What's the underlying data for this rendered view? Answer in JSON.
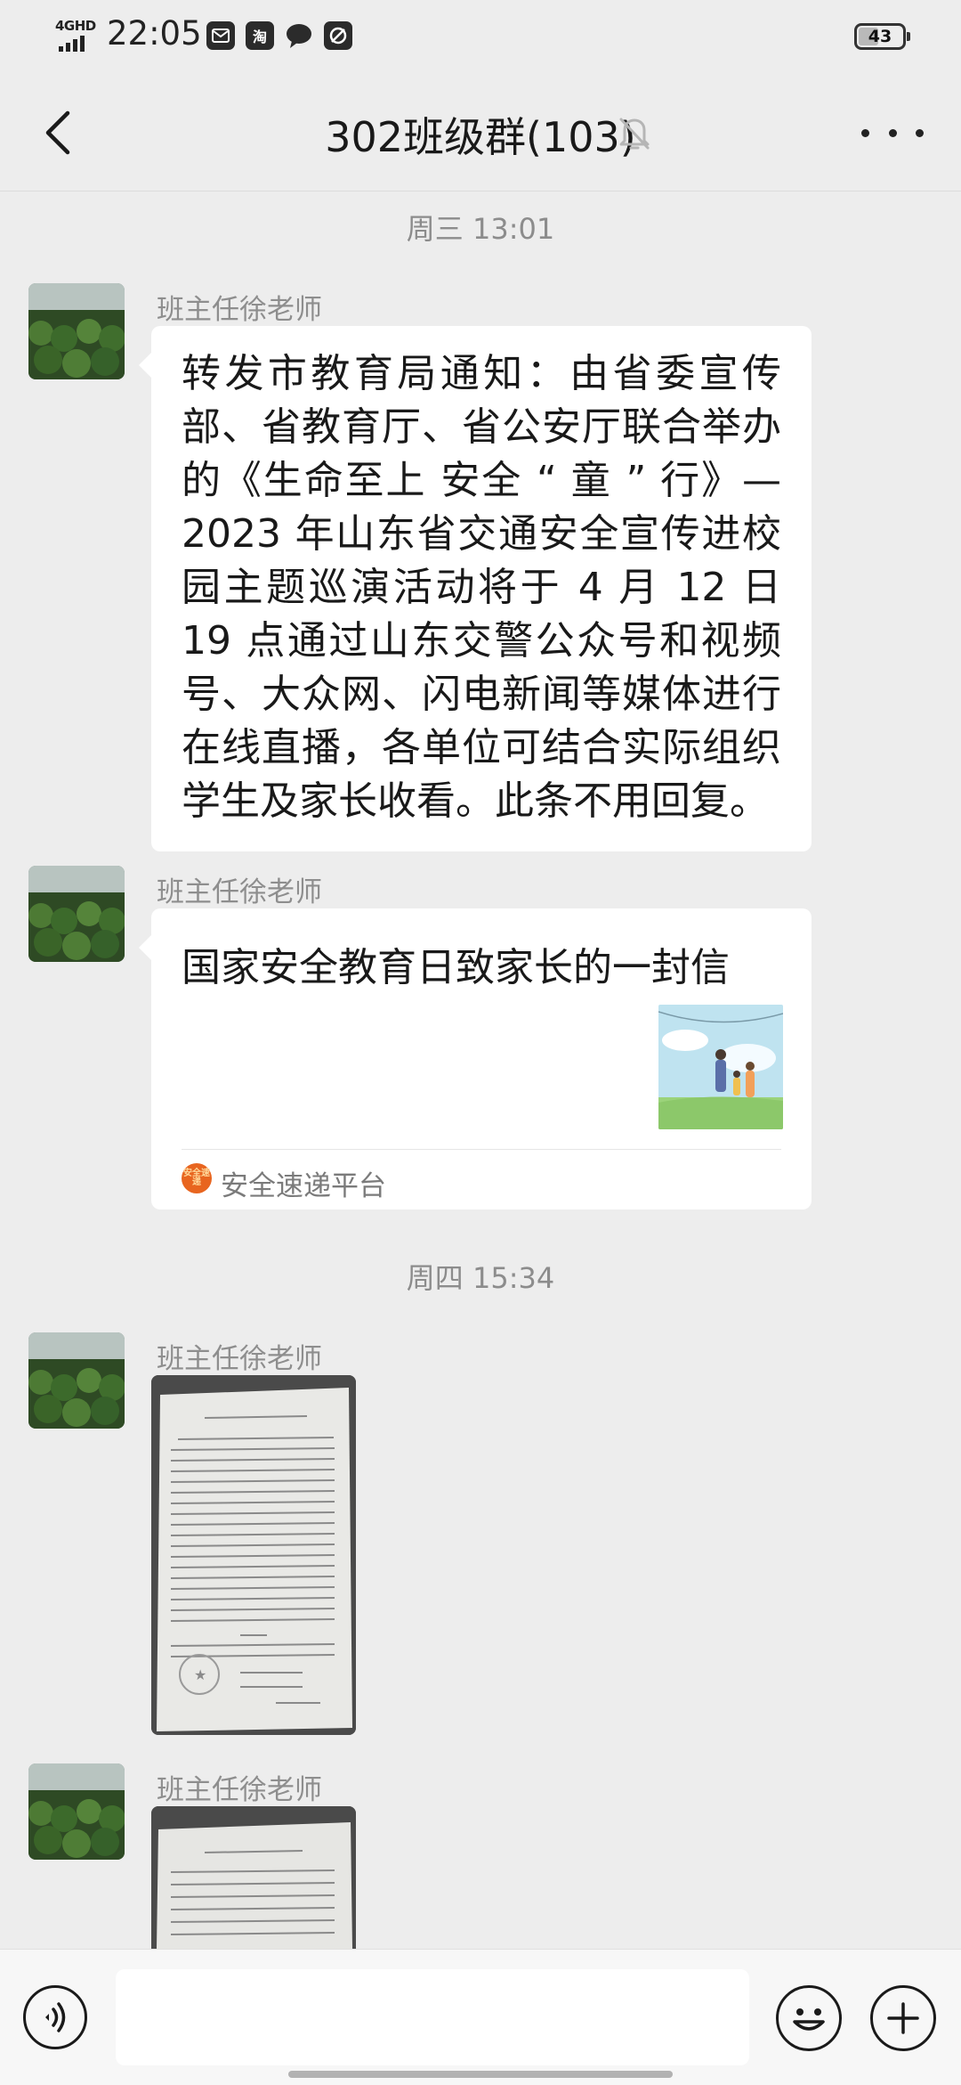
{
  "status_bar": {
    "network": "4GHD",
    "time": "22:05",
    "notification_icons": [
      "message-icon",
      "taobao-icon",
      "chat-bubble-icon",
      "sync-icon"
    ],
    "taobao_glyph": "淘",
    "battery_level": "43"
  },
  "header": {
    "title": "302班级群(103)",
    "muted": true
  },
  "messages": {
    "time_1": "周三 13:01",
    "msg1": {
      "sender": "班主任徐老师",
      "text": "转发市教育局通知：由省委宣传部、省教育厅、省公安厅联合举办的《生命至上 安全 “ 童 ” 行》—2023 年山东省交通安全宣传进校园主题巡演活动将于 4 月 12 日 19 点通过山东交警公众号和视频号、大众网、闪电新闻等媒体进行在线直播，各单位可结合实际组织学生及家长收看。此条不用回复。"
    },
    "msg2": {
      "sender": "班主任徐老师",
      "card_title": "国家安全教育日致家长的一封信",
      "card_source": "安全速递平台",
      "source_logo_text": "安全速递"
    },
    "time_2": "周四 15:34",
    "msg3": {
      "sender": "班主任徐老师",
      "image": "document-photo"
    },
    "msg4": {
      "sender": "班主任徐老师",
      "image": "document-photo"
    }
  },
  "input_bar": {
    "placeholder": ""
  },
  "colors": {
    "background": "#ededed",
    "bubble": "#ffffff",
    "timestamp": "#8c8c8c"
  }
}
